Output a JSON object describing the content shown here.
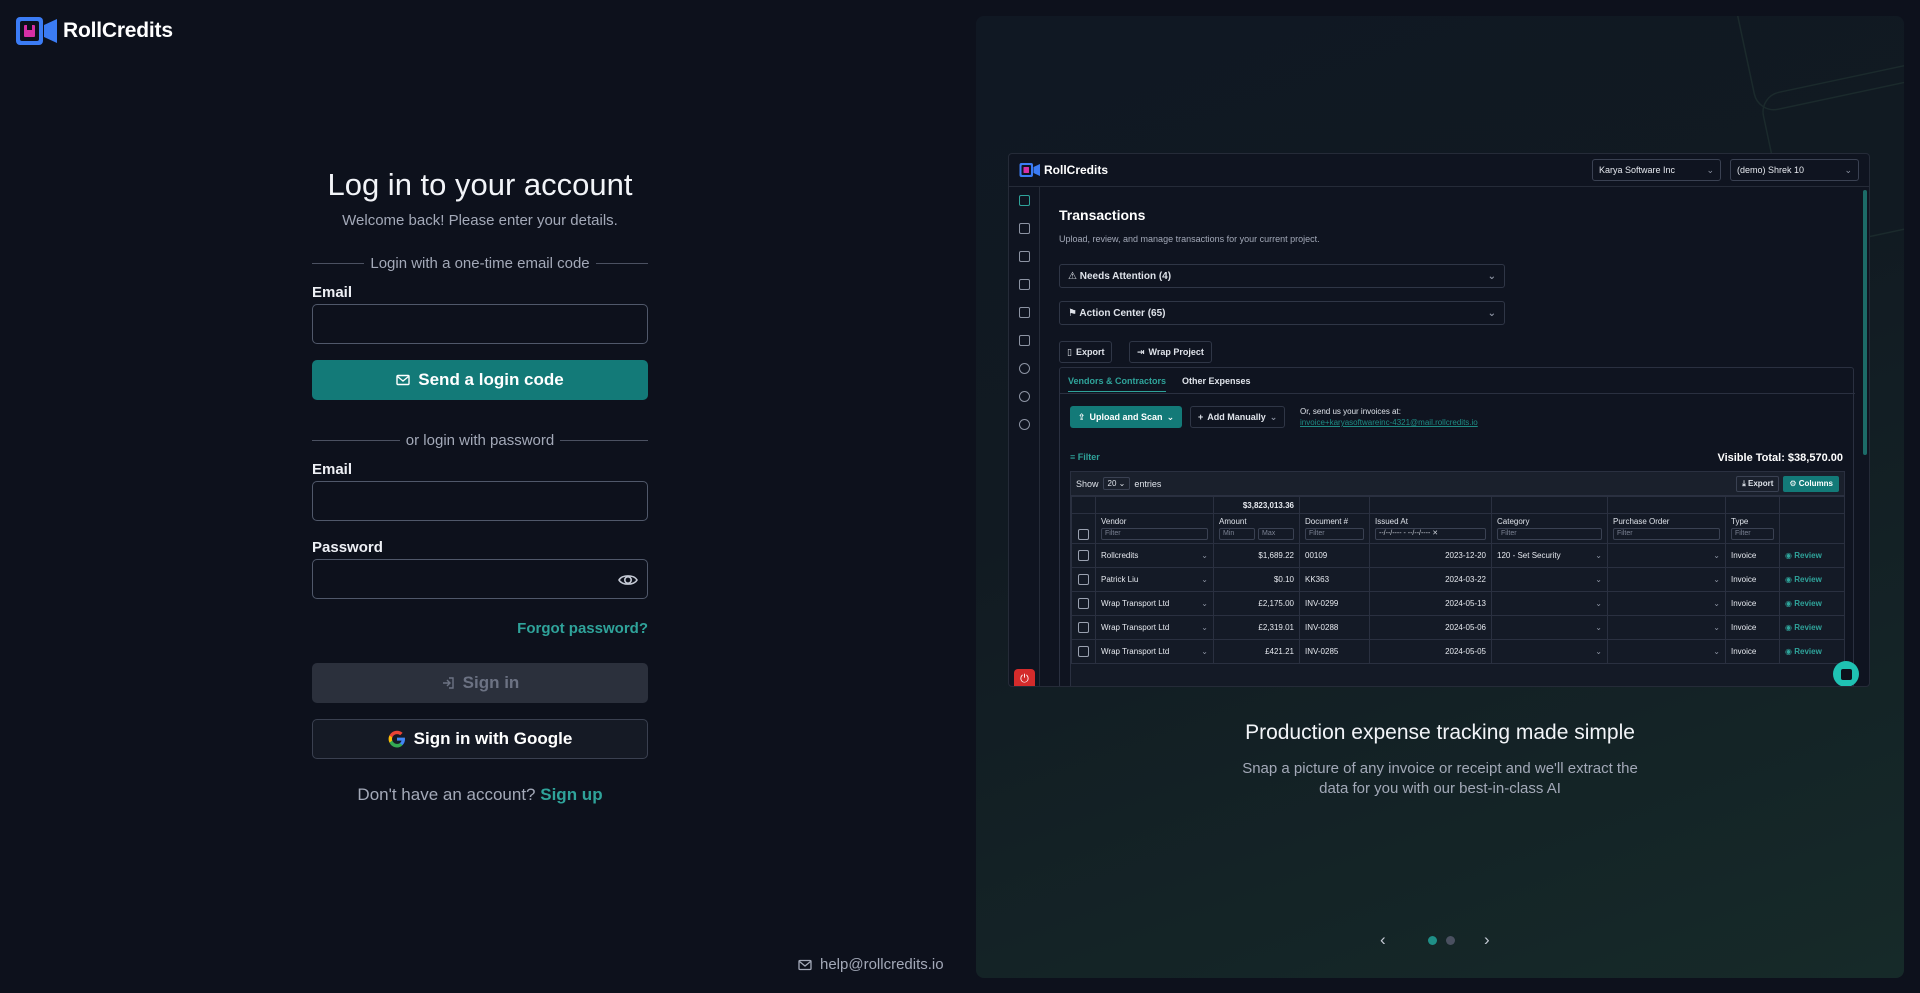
{
  "brand": {
    "name": "RollCredits"
  },
  "login": {
    "title": "Log in to your account",
    "subtitle": "Welcome back! Please enter your details.",
    "otp_divider": "Login with a one-time email code",
    "otp_email_label": "Email",
    "otp_email_value": "",
    "send_code_label": "Send a login code",
    "password_divider": "or login with password",
    "email_label": "Email",
    "email_value": "",
    "password_label": "Password",
    "password_value": "",
    "forgot_label": "Forgot password?",
    "signin_label": "Sign in",
    "google_label": "Sign in with Google",
    "no_account_text": "Don't have an account?",
    "signup_label": "Sign up"
  },
  "footer": {
    "email": "help@rollcredits.io"
  },
  "preview": {
    "company_select": "Karya Software Inc",
    "project_select": "(demo) Shrek 10",
    "title": "Transactions",
    "subtitle": "Upload, review, and manage transactions for your current project.",
    "needs_attention": "Needs Attention (4)",
    "action_center": "Action Center (65)",
    "export_label": "Export",
    "wrap_label": "Wrap Project",
    "tab_vendors": "Vendors & Contractors",
    "tab_other": "Other Expenses",
    "upload_label": "Upload and Scan",
    "add_label": "Add Manually",
    "send_us": "Or, send us your invoices at:",
    "send_email": "invoice+karyasoftwareinc-4321@mail.rollcredits.io",
    "filter_label": "Filter",
    "visible_total": "Visible Total: $38,570.00",
    "show_label": "Show",
    "entries_value": "20",
    "entries_label": "entries",
    "table_export": "Export",
    "columns_label": "Columns",
    "amount_sum": "$3,823,013.36",
    "columns": [
      "Vendor",
      "Amount",
      "Document #",
      "Issued At",
      "Category",
      "Purchase Order",
      "Type"
    ],
    "filters": {
      "text": "Filter",
      "min": "Min",
      "max": "Max",
      "date": "--/--/---- - --/--/----"
    },
    "rows": [
      {
        "vendor": "Rollcredits",
        "amount": "$1,689.22",
        "doc": "00109",
        "issued": "2023-12-20",
        "category": "120 - Set Security",
        "po": "",
        "type": "Invoice",
        "action": "Review"
      },
      {
        "vendor": "Patrick Liu",
        "amount": "$0.10",
        "doc": "KK363",
        "issued": "2024-03-22",
        "category": "",
        "po": "",
        "type": "Invoice",
        "action": "Review"
      },
      {
        "vendor": "Wrap Transport Ltd",
        "amount": "£2,175.00",
        "doc": "INV-0299",
        "issued": "2024-05-13",
        "category": "",
        "po": "",
        "type": "Invoice",
        "action": "Review"
      },
      {
        "vendor": "Wrap Transport Ltd",
        "amount": "£2,319.01",
        "doc": "INV-0288",
        "issued": "2024-05-06",
        "category": "",
        "po": "",
        "type": "Invoice",
        "action": "Review"
      },
      {
        "vendor": "Wrap Transport Ltd",
        "amount": "£421.21",
        "doc": "INV-0285",
        "issued": "2024-05-05",
        "category": "",
        "po": "",
        "type": "Invoice",
        "action": "Review"
      }
    ]
  },
  "caption": {
    "title": "Production expense tracking made simple",
    "subtitle": "Snap a picture of any invoice or receipt and we'll extract the data for you with our best-in-class AI"
  },
  "carousel": {
    "active_index": 0,
    "count": 2
  },
  "colors": {
    "accent": "#137a78",
    "link": "#2fa39a",
    "background": "#0d111c"
  }
}
